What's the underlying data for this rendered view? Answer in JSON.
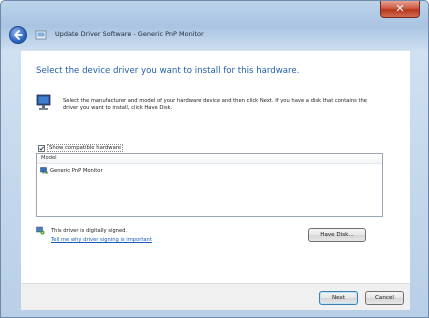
{
  "window": {
    "close_label": "✕"
  },
  "navbar": {
    "title": "Update Driver Software - Generic PnP Monitor"
  },
  "main": {
    "heading": "Select the device driver you want to install for this hardware.",
    "instructions": "Select the manufacturer and model of your hardware device and then click Next. If you have a disk that contains the driver you want to install, click Have Disk.",
    "compatible_checkbox": {
      "label": "Show compatible hardware",
      "checked": true
    },
    "model_list": {
      "header": "Model",
      "items": [
        "Generic PnP Monitor"
      ]
    },
    "signed_text": "This driver is digitally signed.",
    "signing_link": "Tell me why driver signing is important",
    "have_disk_label": "Have Disk..."
  },
  "footer": {
    "next_label": "Next",
    "cancel_label": "Cancel"
  },
  "colors": {
    "heading": "#1f5fa8",
    "link": "#1a5bbf",
    "close_button": "#c9462f"
  },
  "icons": [
    "back-arrow-icon",
    "wizard-icon",
    "monitor-icon",
    "checkmark-icon",
    "monitor-driver-icon",
    "signed-driver-icon"
  ]
}
